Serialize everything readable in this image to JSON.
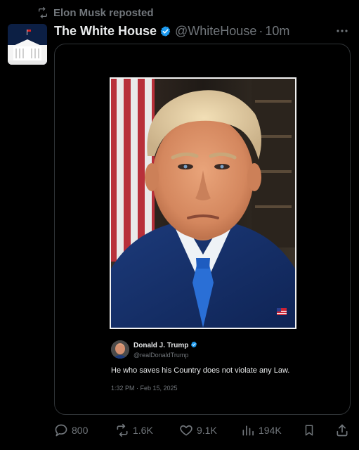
{
  "repost": {
    "label": "Elon Musk reposted",
    "icon": "repost-icon"
  },
  "post": {
    "author_name": "The White House",
    "handle": "@WhiteHouse",
    "separator": "·",
    "time": "10m",
    "verified_icon": "verified-badge-icon",
    "more_icon": "more-icon"
  },
  "quoted": {
    "author_name": "Donald J. Trump",
    "handle": "@realDonaldTrump",
    "text": "He who saves his Country does not violate any Law.",
    "time": "1:32 PM · Feb 15, 2025"
  },
  "actions": {
    "replies": "800",
    "reposts": "1.6K",
    "likes": "9.1K",
    "views": "194K"
  },
  "colors": {
    "background": "#000000",
    "text": "#e7e9ea",
    "muted": "#71767b",
    "border": "#2f3336",
    "verified": "#1d9bf0"
  }
}
